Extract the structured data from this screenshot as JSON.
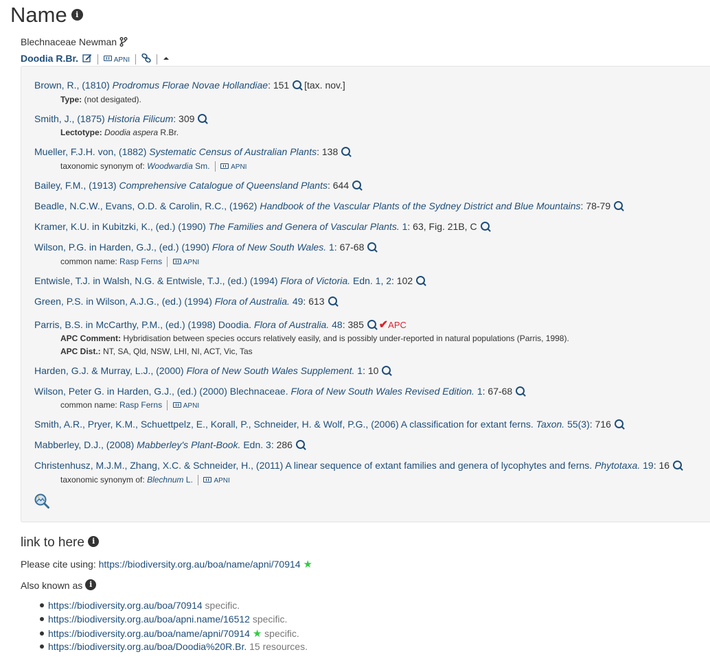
{
  "page": {
    "title": "Name",
    "family": "Blechnaceae Newman",
    "name": "Doodia R.Br.",
    "apni_label": "APNI"
  },
  "refs": [
    {
      "author": "Brown, R., (1810)",
      "title": "Prodromus Florae Novae Hollandiae",
      "after": ": 151",
      "suffix": "[tax. nov.]"
    },
    {
      "author": "Smith, J., (1875)",
      "title": "Historia Filicum",
      "after": ": 309"
    },
    {
      "author": "Mueller, F.J.H. von, (1882)",
      "title": "Systematic Census of Australian Plants",
      "after": ": 138"
    },
    {
      "author": "Bailey, F.M., (1913)",
      "title": "Comprehensive Catalogue of Queensland Plants",
      "after": ": 644"
    },
    {
      "author": "Beadle, N.C.W., Evans, O.D. & Carolin, R.C., (1962)",
      "title": "Handbook of the Vascular Plants of the Sydney District and Blue Mountains",
      "after": ": 78-79"
    },
    {
      "author": "Kramer, K.U. in Kubitzki, K., (ed.) (1990)",
      "title": "The Families and Genera of Vascular Plants.",
      "vol": " 1",
      "after": ": 63, Fig. 21B, C"
    },
    {
      "author": "Wilson, P.G. in Harden, G.J., (ed.) (1990)",
      "title": "Flora of New South Wales.",
      "vol": " 1",
      "after": ": 67-68"
    },
    {
      "author": "Entwisle, T.J. in Walsh, N.G. & Entwisle, T.J., (ed.) (1994)",
      "title": "Flora of Victoria.",
      "vol": " Edn. 1, 2",
      "after": ": 102"
    },
    {
      "author": "Green, P.S. in Wilson, A.J.G., (ed.) (1994)",
      "title": "Flora of Australia.",
      "vol": " 49",
      "after": ": 613"
    },
    {
      "author": "Parris, B.S. in McCarthy, P.M., (ed.) (1998) Doodia.",
      "title": "Flora of Australia.",
      "vol": " 48",
      "after": ": 385",
      "apc": "APC"
    },
    {
      "author": "Harden, G.J. & Murray, L.J., (2000)",
      "title": "Flora of New South Wales Supplement.",
      "vol": " 1",
      "after": ": 10"
    },
    {
      "author": "Wilson, Peter G. in Harden, G.J., (ed.) (2000) Blechnaceae.",
      "title": "Flora of New South Wales Revised Edition.",
      "vol": " 1",
      "after": ": 67-68"
    },
    {
      "author": "Smith, A.R., Pryer, K.M., Schuettpelz, E., Korall, P., Schneider, H. & Wolf, P.G., (2006) A classification for extant ferns.",
      "title": "Taxon.",
      "vol": " 55(3)",
      "after": ": 716"
    },
    {
      "author": "Mabberley, D.J., (2008)",
      "title": "Mabberley's Plant-Book.",
      "vol": " Edn. 3",
      "after": ": 286"
    },
    {
      "author": "Christenhusz, M.J.M., Zhang, X.C. & Schneider, H., (2011) A linear sequence of extant families and genera of lycophytes and ferns.",
      "title": "Phytotaxa.",
      "vol": " 19",
      "after": ": 16"
    }
  ],
  "subs": {
    "type_label": "Type:",
    "type_value": "(not desigated).",
    "lecto_label": "Lectotype:",
    "lecto_name": "Doodia aspera",
    "lecto_author": " R.Br.",
    "syn_label": "taxonomic synonym of:",
    "syn1_name": "Woodwardia",
    "syn1_author": " Sm.",
    "common_label": "common name:",
    "common_value": "Rasp Ferns",
    "apc_comment_label": "APC Comment:",
    "apc_comment": "Hybridisation between species occurs relatively easily, and is possibly under-reported in natural populations (Parris, 1998).",
    "apc_dist_label": "APC Dist.:",
    "apc_dist": "NT, SA, Qld, NSW, LHI, NI, ACT, Vic, Tas",
    "syn2_name": "Blechnum",
    "syn2_author": " L."
  },
  "link": {
    "heading": "link to here",
    "cite_label": "Please cite using:",
    "cite_url": "https://biodiversity.org.au/boa/name/apni/70914",
    "aka_label": "Also known as",
    "aka": [
      {
        "url": "https://biodiversity.org.au/boa/70914",
        "note": " specific.",
        "star": false
      },
      {
        "url": "https://biodiversity.org.au/boa/apni.name/16512",
        "note": " specific.",
        "star": false
      },
      {
        "url": "https://biodiversity.org.au/boa/name/apni/70914",
        "note": " specific.",
        "star": true
      },
      {
        "url": "https://biodiversity.org.au/boa/Doodia%20R.Br.",
        "note": " 15 resources.",
        "star": false
      }
    ]
  },
  "colors": {
    "link": "#1f4e79",
    "apc": "#d9232d",
    "star": "#2ecc40",
    "panel": "#f5f5f5"
  },
  "icons": [
    "info-icon",
    "branch-icon",
    "edit-icon",
    "keyboard-icon",
    "link-icon",
    "caret-up-icon",
    "search-icon",
    "check-icon",
    "gallery-search-icon",
    "star-icon"
  ]
}
